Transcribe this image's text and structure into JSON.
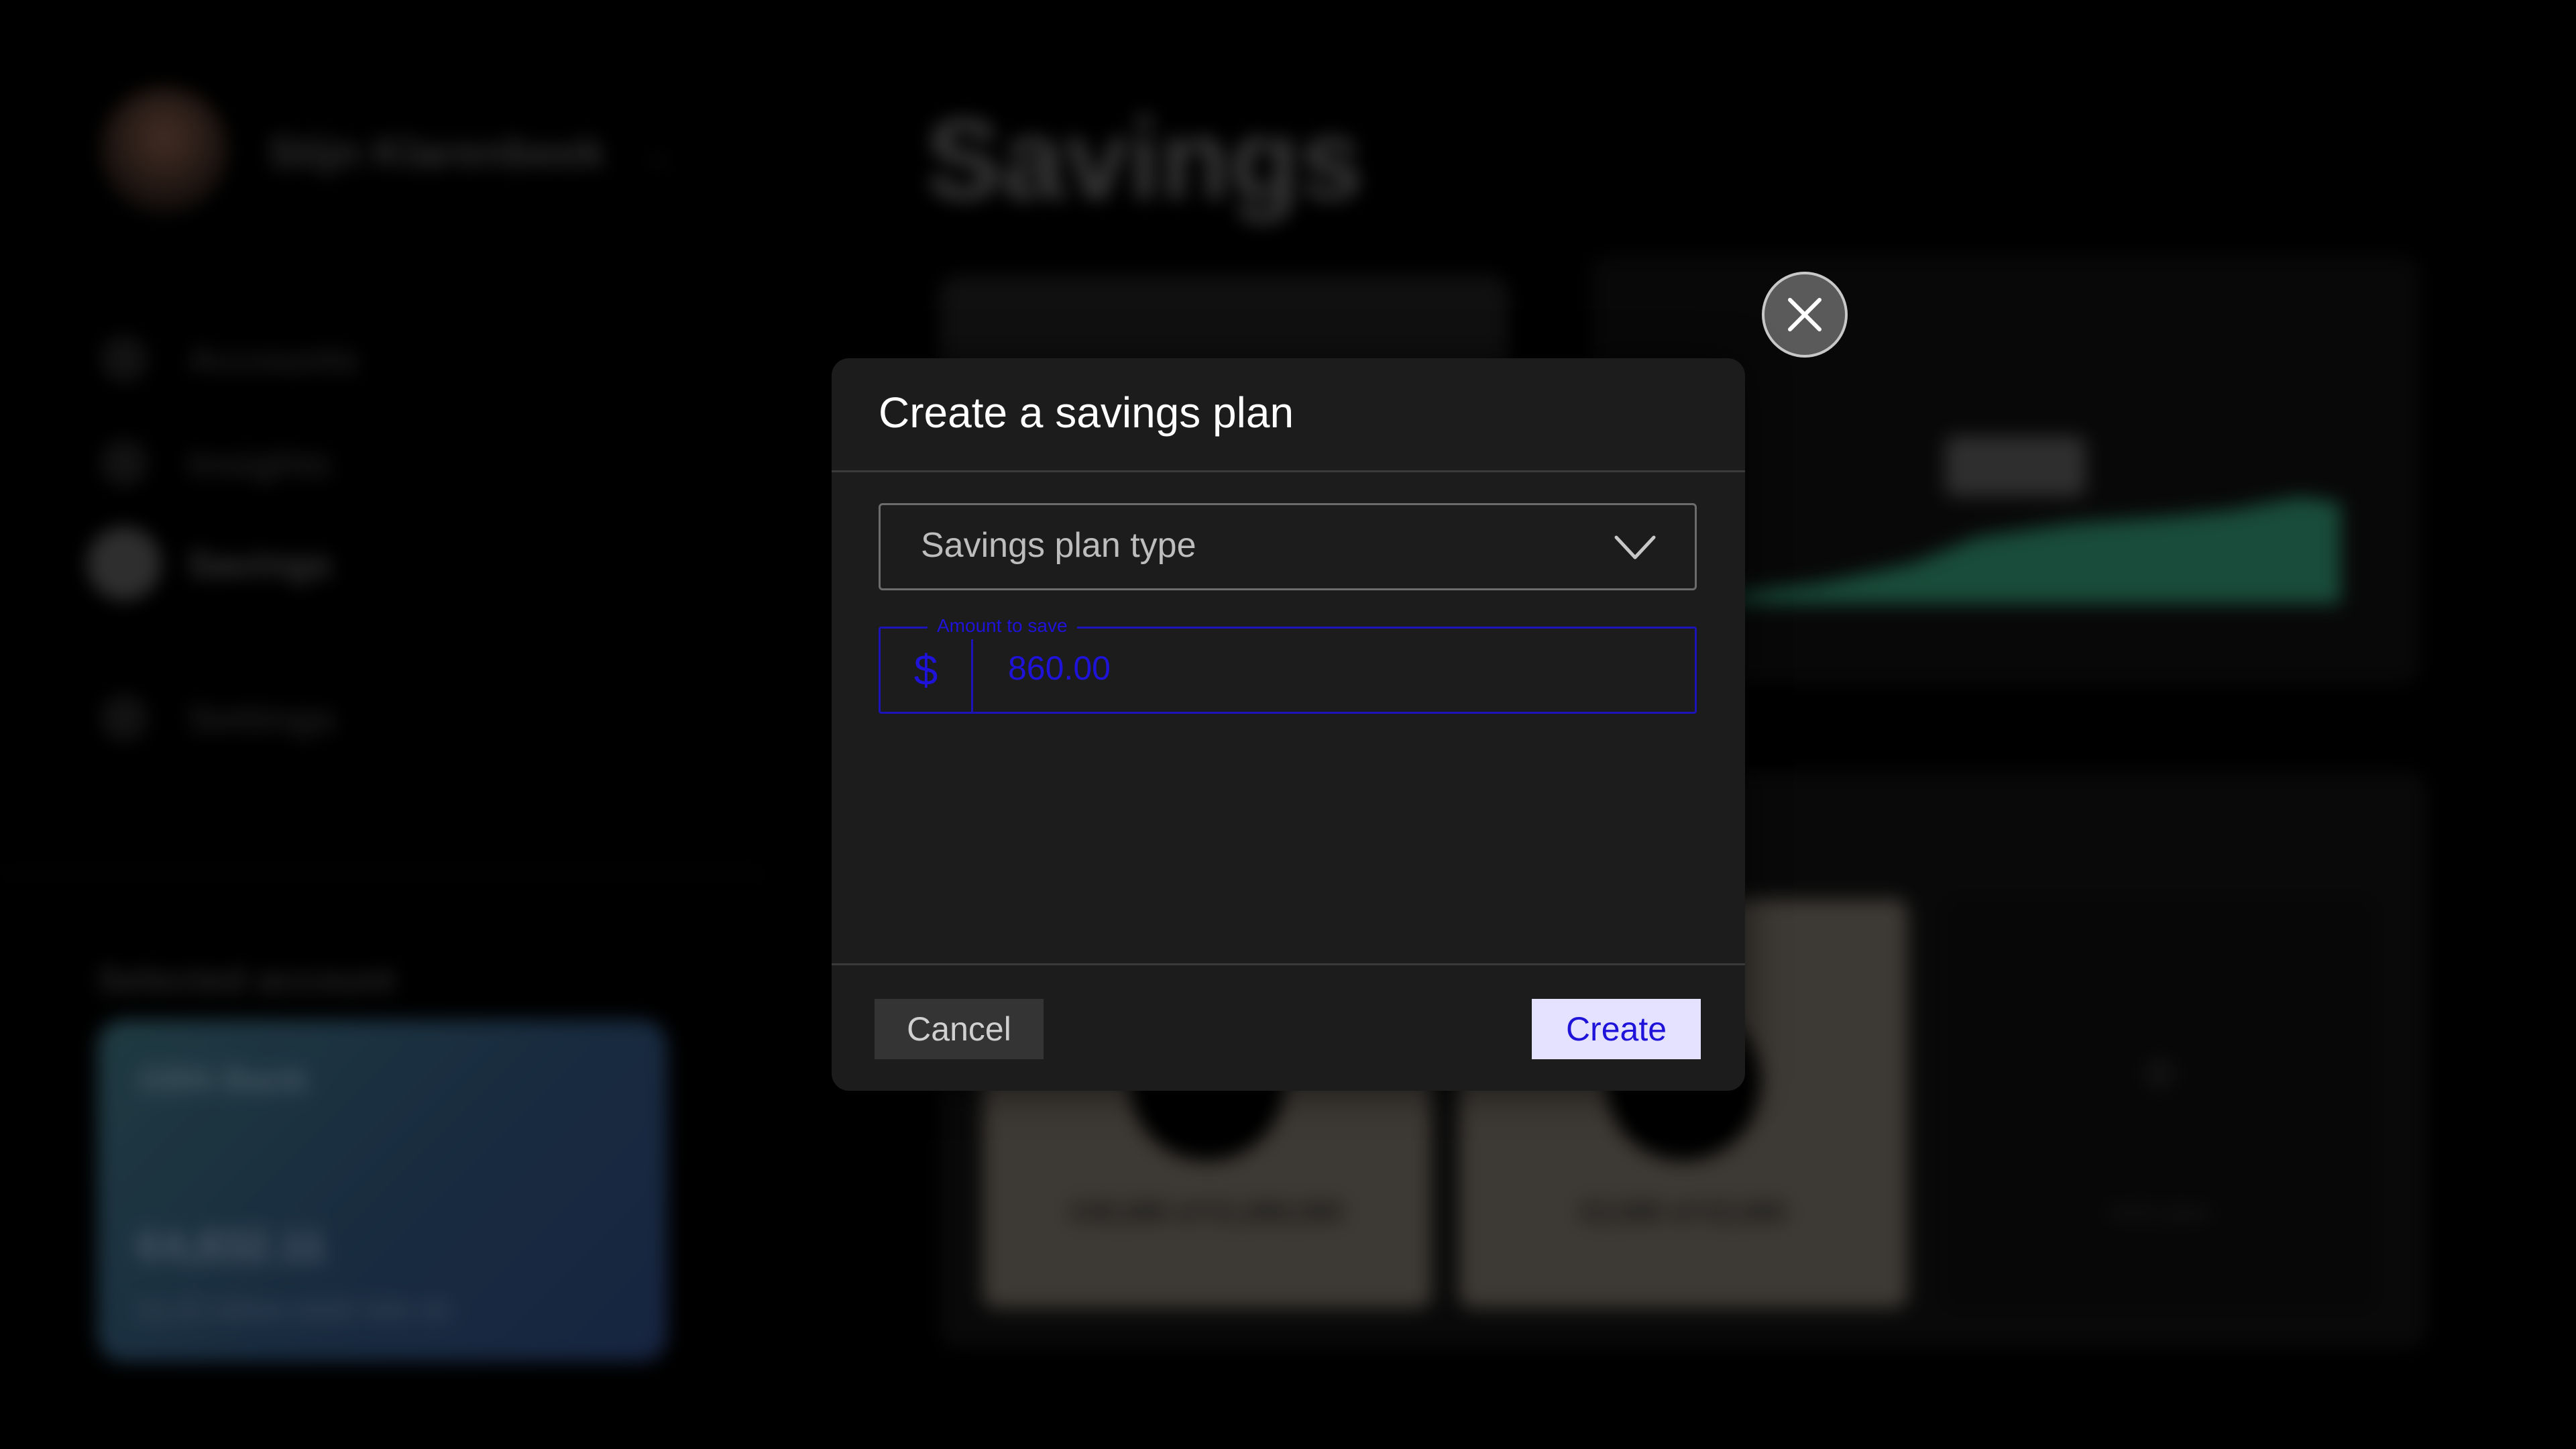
{
  "background": {
    "user_name": "Stijn Klarenbeek",
    "page_title": "Savings",
    "nav": [
      {
        "label": "Accounts",
        "icon": "wallet-icon"
      },
      {
        "label": "Insights",
        "icon": "chart-icon"
      },
      {
        "label": "Savings",
        "icon": "piggy-bank-icon",
        "active": true
      },
      {
        "label": "Settings",
        "icon": "gear-icon"
      }
    ],
    "selected_account_label": "Selected account",
    "card": {
      "bank": "ABN Bank",
      "balance": "€4,832.11",
      "number": "NL45 ABNA 0000 000 00"
    },
    "chart_tag": "$4,832",
    "tiles": [
      {
        "label": "€45,000 of €1,000,000"
      },
      {
        "label": "€2,000 of €2,000"
      }
    ],
    "add_tile_label": "Add plan"
  },
  "modal": {
    "title": "Create a savings plan",
    "plan_type_placeholder": "Savings plan type",
    "amount_label": "Amount to save",
    "currency_symbol": "$",
    "amount_value": "860.00",
    "cancel_label": "Cancel",
    "create_label": "Create"
  },
  "colors": {
    "accent": "#1f13d9",
    "create_bg": "#e4e2ff",
    "modal_bg": "#1c1c1c"
  }
}
